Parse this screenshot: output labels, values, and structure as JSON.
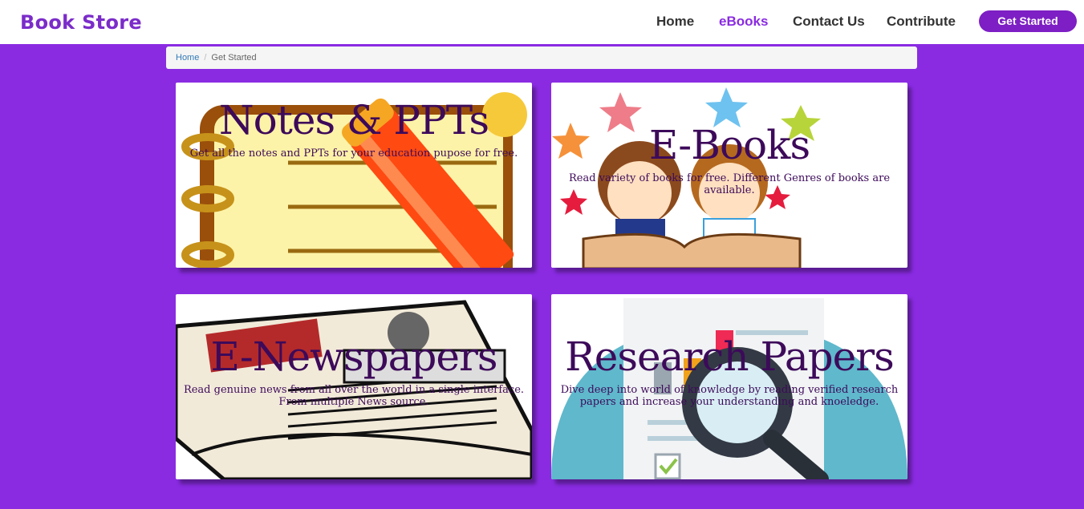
{
  "header": {
    "brand": "Book Store",
    "nav": [
      "Home",
      "eBooks",
      "Contact Us",
      "Contribute"
    ],
    "active_nav": "eBooks",
    "cta_label": "Get Started"
  },
  "breadcrumb": {
    "items": [
      "Home",
      "Get Started"
    ]
  },
  "cards": [
    {
      "title": "Notes & PPTs",
      "description": "Get all the notes and PPTs for your education pupose for free.",
      "image": "notebook-pencil-illustration"
    },
    {
      "title": "E-Books",
      "description": "Read variety of books for free. Different Genres of books are available.",
      "image": "kids-reading-book-illustration"
    },
    {
      "title": "E-Newspapers",
      "description": "Read genuine news from all over the world in a single interface. From multiple News source.",
      "image": "newspaper-illustration"
    },
    {
      "title": "Research Papers",
      "description": "Dive deep into world of knowledge by reading verified research papers and increase your understanding and knoeledge.",
      "image": "magnifier-document-illustration"
    }
  ],
  "colors": {
    "background": "#8a2be2",
    "brand": "#7b2cc9",
    "cta": "#7d1fc4",
    "card_text": "#3d0a5a"
  }
}
